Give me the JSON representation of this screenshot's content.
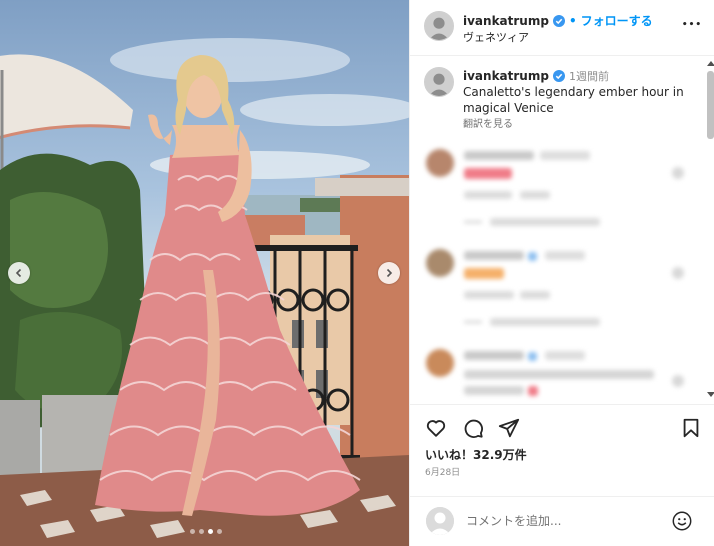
{
  "post": {
    "username": "ivankatrump",
    "separator": "•",
    "follow_label": "フォローする",
    "location": "ヴェネツィア",
    "more_label": "•••"
  },
  "caption": {
    "username": "ivankatrump",
    "time": "1週間前",
    "text": "Canaletto's legendary ember hour in magical Venice",
    "translate_label": "翻訳を見る"
  },
  "stats": {
    "likes": "いいね！32.9万件",
    "date": "6月28日"
  },
  "comment_box": {
    "placeholder": "コメントを追加..."
  },
  "carousel": {
    "slide_count": 4,
    "active_index": 2
  },
  "colors": {
    "accent": "#0095f6",
    "verified": "#3897f0"
  }
}
